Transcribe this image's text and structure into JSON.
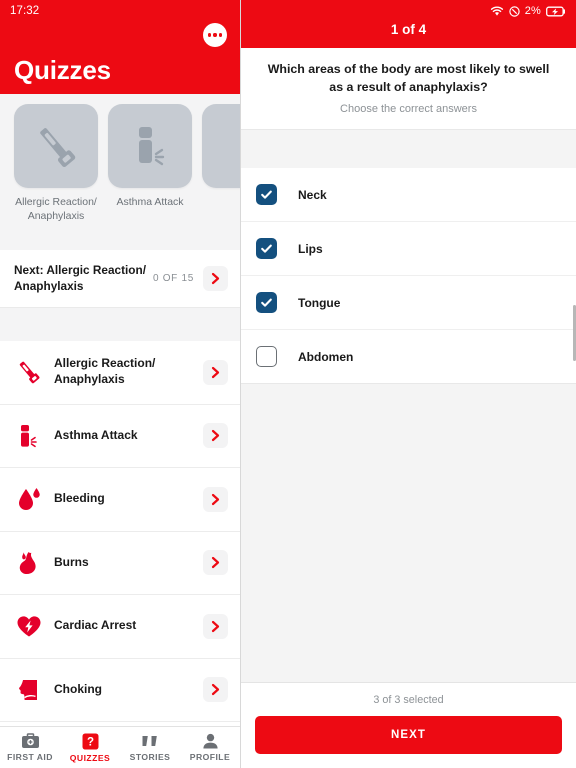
{
  "theme": {
    "brand_red": "#ED0A13",
    "checkbox_navy": "#14507F",
    "panel_grey": "#F4F4F4"
  },
  "status_bar": {
    "time": "17:32",
    "wifi_icon": "wifi-icon",
    "mute_icon": "do-not-disturb-icon",
    "battery_percent": "2%",
    "battery_icon": "battery-charging-icon"
  },
  "left_panel": {
    "header": {
      "title": "Quizzes",
      "more_icon": "more-options-icon"
    },
    "carousel": [
      {
        "label": "Allergic Reaction/ Anaphylaxis",
        "icon": "epipen-icon"
      },
      {
        "label": "Asthma Attack",
        "icon": "inhaler-icon"
      },
      {
        "label": "",
        "icon": "bleeding-icon"
      }
    ],
    "next_up": {
      "title": "Next: Allergic Reaction/ Anaphylaxis",
      "count": "0 OF 15",
      "chevron_icon": "chevron-right-icon"
    },
    "quiz_rows": [
      {
        "label": "Allergic Reaction/ Anaphylaxis",
        "icon": "epipen-icon"
      },
      {
        "label": "Asthma Attack",
        "icon": "inhaler-icon"
      },
      {
        "label": "Bleeding",
        "icon": "blood-drop-icon"
      },
      {
        "label": "Burns",
        "icon": "flame-icon"
      },
      {
        "label": "Cardiac Arrest",
        "icon": "heart-lightning-icon"
      },
      {
        "label": "Choking",
        "icon": "head-profile-icon"
      }
    ],
    "tabs": [
      {
        "label": "FIRST AID",
        "icon": "first-aid-kit-icon",
        "active": false
      },
      {
        "label": "QUIZZES",
        "icon": "question-mark-icon",
        "active": true
      },
      {
        "label": "STORIES",
        "icon": "quotation-marks-icon",
        "active": false
      },
      {
        "label": "PROFILE",
        "icon": "person-icon",
        "active": false
      }
    ]
  },
  "right_panel": {
    "progress": "1 of 4",
    "question": "Which areas of the body are most likely to swell as a result of anaphylaxis?",
    "instruction": "Choose the correct answers",
    "answers": [
      {
        "label": "Neck",
        "checked": true
      },
      {
        "label": "Lips",
        "checked": true
      },
      {
        "label": "Tongue",
        "checked": true
      },
      {
        "label": "Abdomen",
        "checked": false
      }
    ],
    "selection_status": "3 of 3 selected",
    "next_button": "NEXT"
  }
}
